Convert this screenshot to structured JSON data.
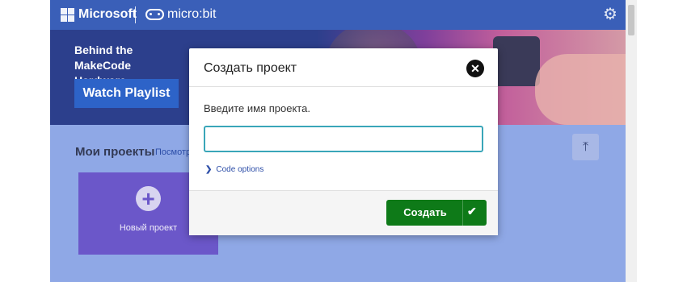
{
  "header": {
    "brand": "Microsoft",
    "product": "micro:bit",
    "settings_icon": "gear-icon"
  },
  "banner": {
    "title": "Behind the MakeCode Hardware",
    "button_label": "Watch Playlist"
  },
  "projects": {
    "title": "Мои проекты",
    "view_all": "Посмотре",
    "new_project_label": "Новый проект",
    "import_icon": "upload-icon"
  },
  "modal": {
    "title": "Создать проект",
    "prompt": "Введите имя проекта.",
    "input_value": "",
    "input_placeholder": "",
    "code_options": "Code options",
    "create_label": "Создать"
  },
  "colors": {
    "header": "#3a5fb8",
    "create_button": "#0e7a18",
    "input_border": "#3aa6b9",
    "new_card": "#6b57c9"
  }
}
